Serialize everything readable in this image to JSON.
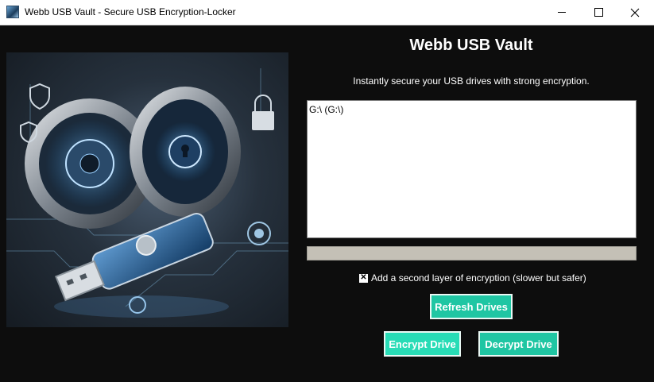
{
  "window": {
    "title": "Webb USB Vault - Secure USB Encryption-Locker",
    "controls": {
      "minimize": "minimize",
      "maximize": "maximize",
      "close": "close"
    }
  },
  "main": {
    "title": "Webb USB Vault",
    "subtitle": "Instantly secure your USB drives with strong encryption.",
    "drives": [
      "G:\\ (G:\\)"
    ],
    "progress": 0,
    "second_layer": {
      "label": "Add a second layer of encryption (slower but safer)",
      "checked": true,
      "mark": "✕"
    },
    "buttons": {
      "refresh": "Refresh Drives",
      "encrypt": "Encrypt Drive",
      "decrypt": "Decrypt Drive"
    }
  },
  "colors": {
    "accent": "#1fc6a3",
    "background": "#0d0d0d",
    "progress_track": "#c4c0b6"
  }
}
